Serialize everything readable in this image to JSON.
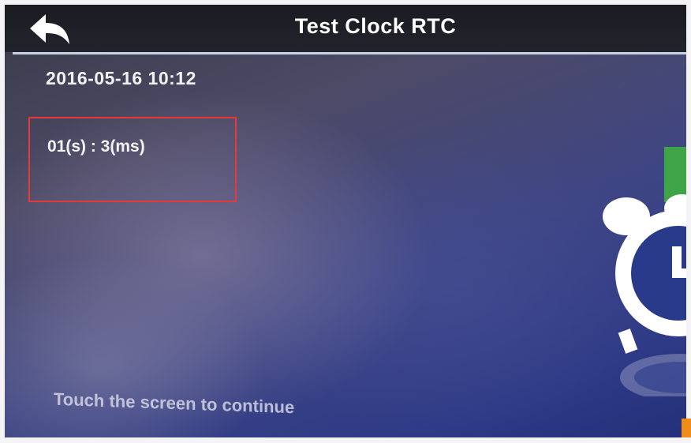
{
  "header": {
    "title": "Test Clock RTC",
    "back_icon": "back-arrow-icon"
  },
  "main": {
    "datetime": "2016-05-16 10:12",
    "rtc_reading": "01(s) : 3(ms)",
    "hint": "Touch the screen to continue"
  },
  "decoration": {
    "clock_icon": "alarm-clock-icon"
  },
  "colors": {
    "highlight_border": "#e53a3a",
    "title_rule": "#c9d3e6",
    "accent_green": "#3fa347"
  }
}
